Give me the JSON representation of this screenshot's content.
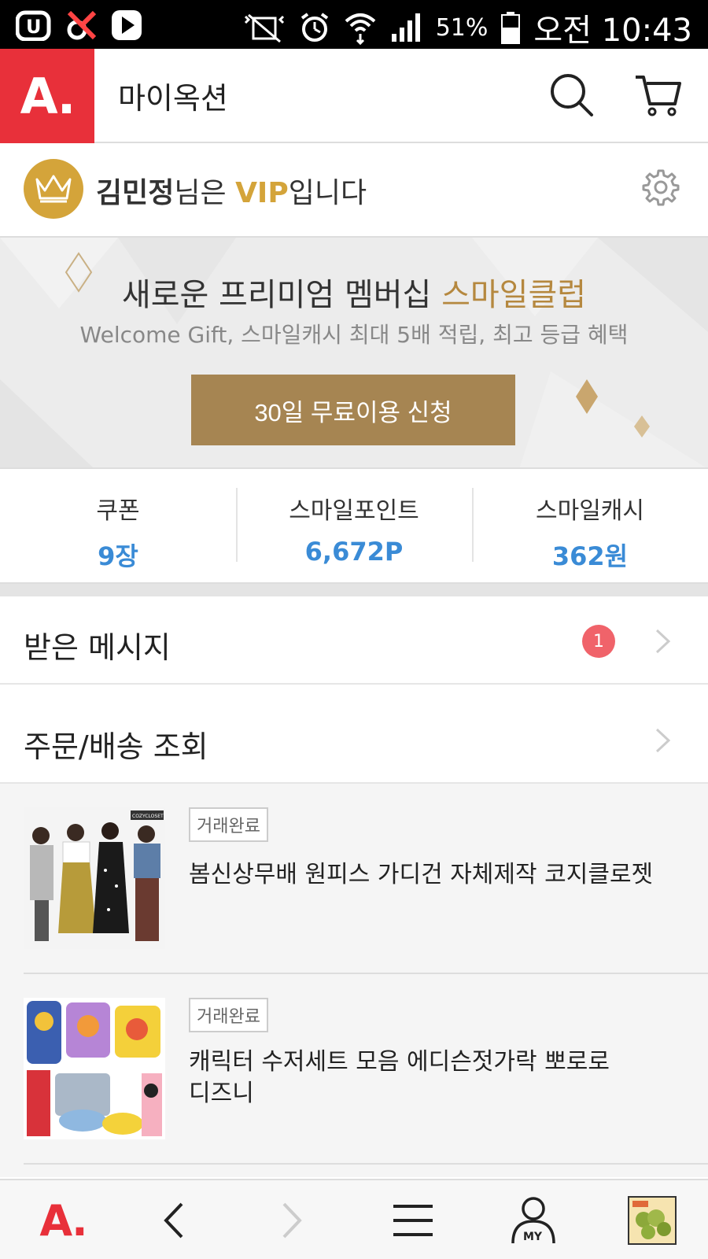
{
  "status_bar": {
    "battery": "51%",
    "time": "오전 10:43"
  },
  "header": {
    "logo": "A.",
    "title": "마이옥션"
  },
  "user": {
    "name": "김민정",
    "suffix1": "님은 ",
    "grade": "VIP",
    "suffix2": "입니다"
  },
  "banner": {
    "title_main": "새로운 프리미엄 멤버십 ",
    "title_accent": "스마일클럽",
    "subtitle": "Welcome Gift, 스마일캐시 최대 5배 적립, 최고 등급 혜택",
    "button_label": "30일 무료이용 신청"
  },
  "points": [
    {
      "label": "쿠폰",
      "value": "9장"
    },
    {
      "label": "스마일포인트",
      "value": "6,672P"
    },
    {
      "label": "스마일캐시",
      "value": "362원"
    }
  ],
  "menu": {
    "messages_label": "받은 메시지",
    "messages_count": "1",
    "orders_label": "주문/배송 조회"
  },
  "orders": [
    {
      "status": "거래완료",
      "title": "봄신상무배 원피스 가디건 자체제작 코지클로젯",
      "thumb_text": "COZYCLOSET"
    },
    {
      "status": "거래완료",
      "title_line1": "캐릭터 수저세트 모음 에디슨젓가락 뽀로로",
      "title_line2": "디즈니"
    }
  ],
  "bottom_nav": {
    "logo": "A.",
    "my_label": "MY"
  },
  "colors": {
    "brand_red": "#e8303a",
    "gold": "#d4a43a",
    "button_brown": "#a68552",
    "value_blue": "#3a8bd6",
    "badge_red": "#f0636a"
  }
}
